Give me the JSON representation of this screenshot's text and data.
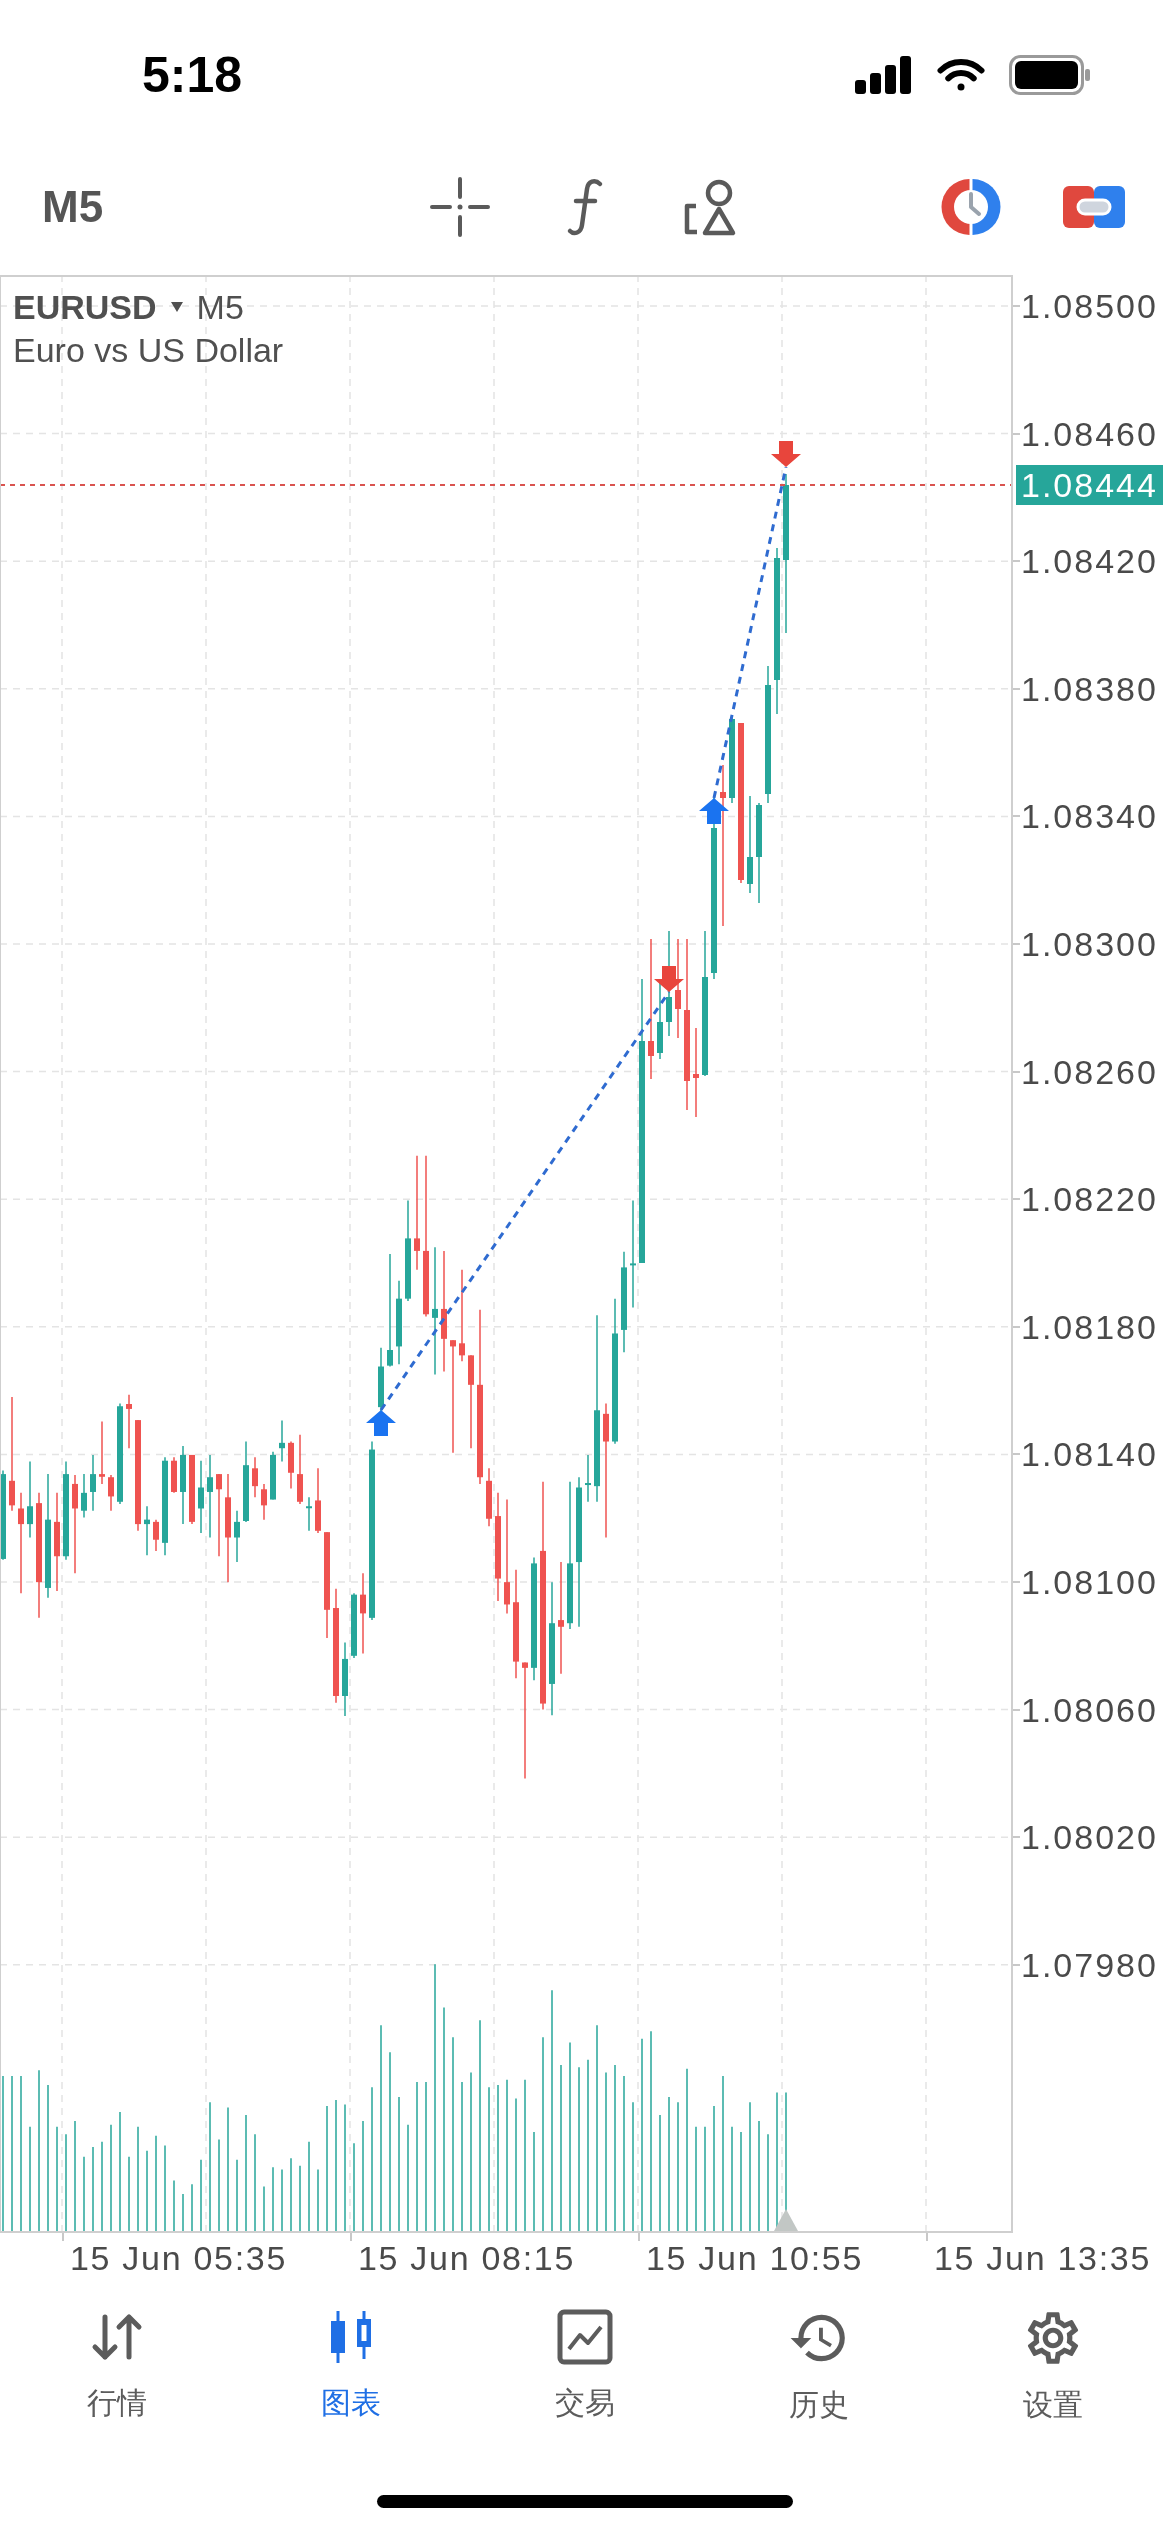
{
  "status_bar": {
    "time": "5:18"
  },
  "toolbar": {
    "timeframe": "M5"
  },
  "chart": {
    "symbol": "EURUSD",
    "timeframe": "M5",
    "description": "Euro vs US Dollar",
    "price_axis": [
      "1.08500",
      "1.08460",
      "1.08420",
      "1.08380",
      "1.08340",
      "1.08300",
      "1.08260",
      "1.08220",
      "1.08180",
      "1.08140",
      "1.08100",
      "1.08060",
      "1.08020",
      "1.07980"
    ],
    "current_price": "1.08444",
    "time_axis": [
      "15 Jun 05:35",
      "15 Jun 08:15",
      "15 Jun 10:55",
      "15 Jun 13:35"
    ],
    "trades": [
      {
        "kind": "buy"
      },
      {
        "kind": "sell"
      },
      {
        "kind": "buy"
      },
      {
        "kind": "sell"
      }
    ]
  },
  "tabs": [
    {
      "label": "行情",
      "selected": false
    },
    {
      "label": "图表",
      "selected": true
    },
    {
      "label": "交易",
      "selected": false
    },
    {
      "label": "历史",
      "selected": false
    },
    {
      "label": "设置",
      "selected": false
    }
  ]
}
